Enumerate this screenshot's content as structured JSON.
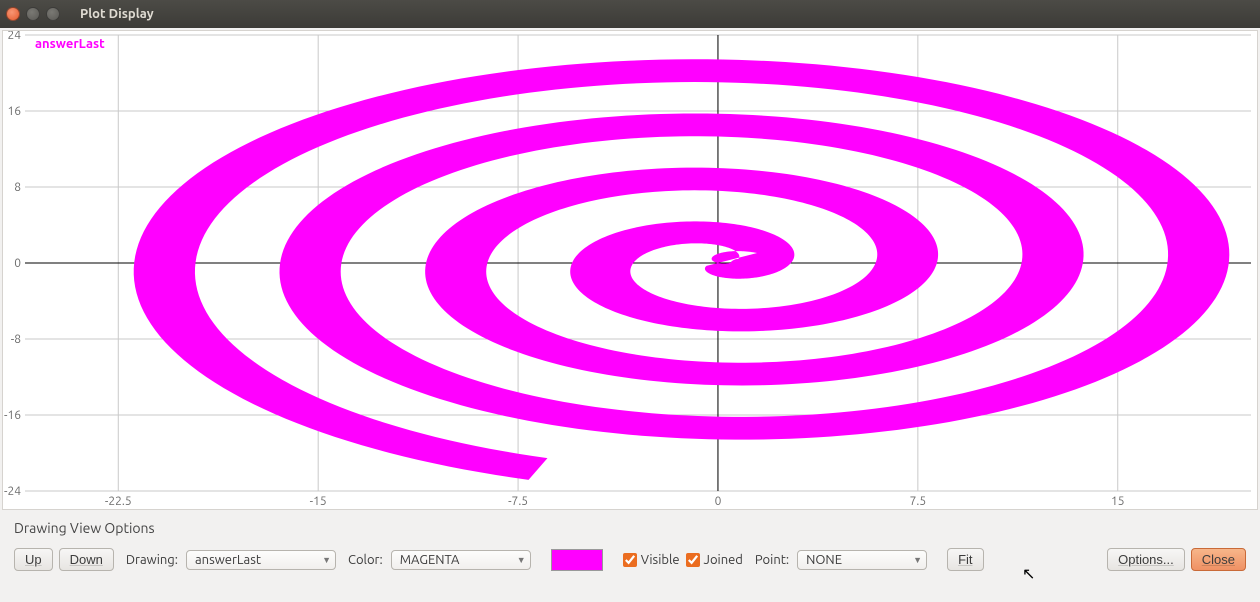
{
  "window": {
    "title": "Plot Display"
  },
  "legend": {
    "series_name": "answerLast"
  },
  "panel": {
    "title": "Drawing View Options",
    "up": "Up",
    "down": "Down",
    "drawing_label": "Drawing:",
    "drawing_value": "answerLast",
    "color_label": "Color:",
    "color_value": "MAGENTA",
    "swatch_hex": "#ff00ff",
    "visible_label": "Visible",
    "visible_checked": true,
    "joined_label": "Joined",
    "joined_checked": true,
    "point_label": "Point:",
    "point_value": "NONE",
    "fit": "Fit",
    "options": "Options...",
    "close": "Close"
  },
  "chart_data": {
    "type": "line",
    "title": "",
    "xlabel": "",
    "ylabel": "",
    "xlim": [
      -26,
      20
    ],
    "ylim": [
      -24,
      24
    ],
    "x_ticks": [
      -22.5,
      -15,
      -7.5,
      0,
      7.5,
      15
    ],
    "y_ticks": [
      -24,
      -16,
      -8,
      0,
      8,
      16,
      24
    ],
    "grid": true,
    "legend_position": "top-left",
    "series": [
      {
        "name": "answerLast",
        "color": "#ff00ff",
        "description": "Spiral ribbon centered near origin; ellipse-shaped spiral with x amplitude growing to ~23 and y amplitude to ~24 over ~4 outward turns; plotted as filled band between inner and outer spiral edges.",
        "approx_envelope": {
          "x_min": -25,
          "x_max": 20,
          "y_min": -22,
          "y_max": 24
        }
      }
    ]
  }
}
